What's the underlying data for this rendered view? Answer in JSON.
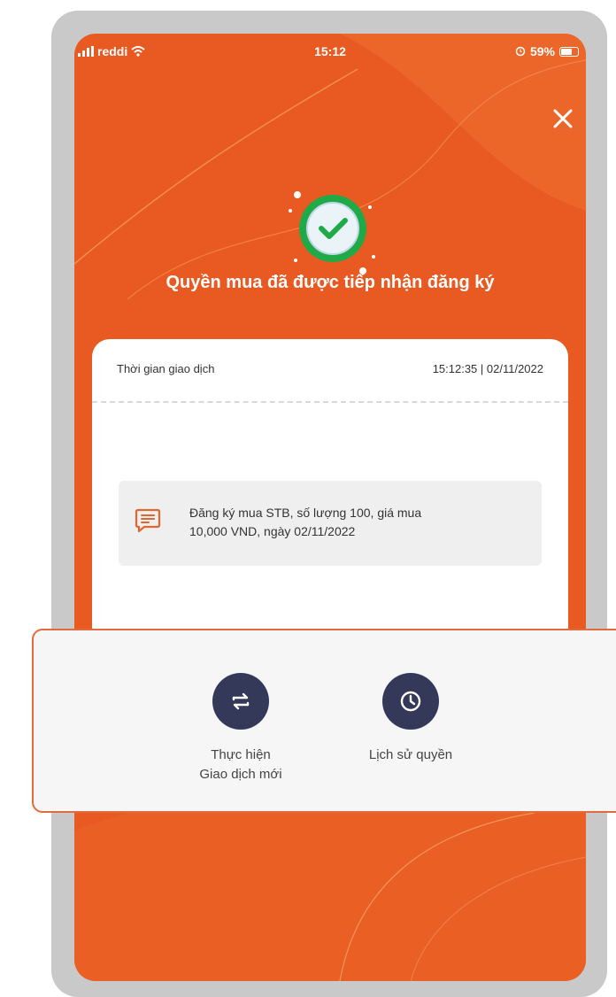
{
  "status_bar": {
    "carrier": "reddi",
    "time": "15:12",
    "battery": "59%",
    "battery_fraction": 0.59
  },
  "success": {
    "title": "Quyền mua đã được tiếp nhận đăng ký",
    "icon": "check-circle-icon"
  },
  "card": {
    "time_label": "Thời gian giao dịch",
    "time_value": "15:12:35 | 02/11/2022",
    "note_line1": "Đăng ký mua STB, số lượng 100, giá mua",
    "note_line2": "10,000 VND, ngày 02/11/2022"
  },
  "actions": [
    {
      "label_line1": "Thực hiện",
      "label_line2": "Giao dịch mới",
      "icon": "swap-arrows-icon"
    },
    {
      "label_line1": "Lịch sử quyền",
      "label_line2": "",
      "icon": "clock-icon"
    }
  ],
  "colors": {
    "screen_bg": "#e85a22",
    "action_circle": "#34395a",
    "success_green": "#1faa47",
    "panel_border": "#e06b3c"
  }
}
